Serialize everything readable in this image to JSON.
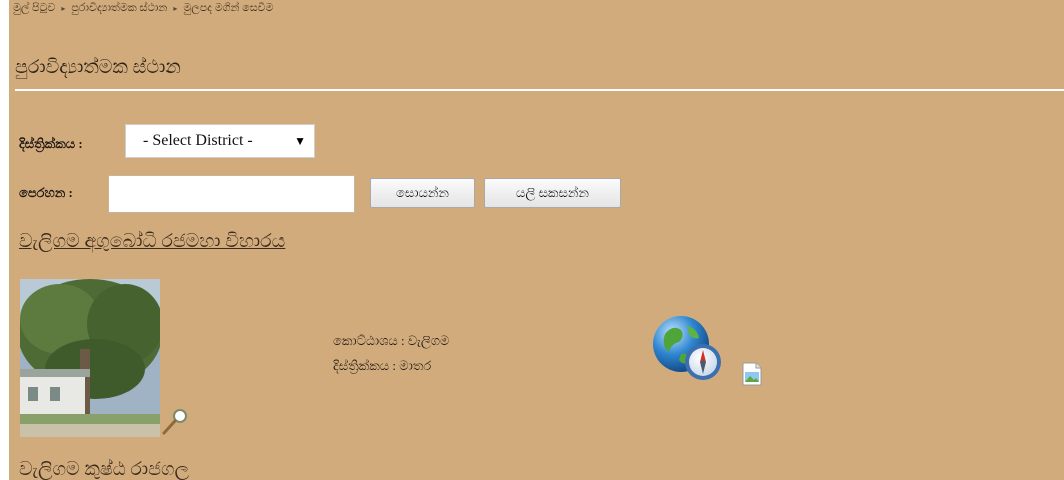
{
  "breadcrumb": {
    "items": [
      "මුල් පිටුව",
      "පුරාවිද්‍යාත්මක ස්ථාන",
      "මුලපද මගින් සෙවීම"
    ],
    "separator": "▸"
  },
  "page": {
    "title": "පුරාවිද්‍යාත්මක ස්ථාන",
    "background": "#d2ab7d"
  },
  "form": {
    "district_label": "දිස්ත්‍රික්කය :",
    "district_selected": "- Select District -",
    "name_label": "පෙරහන :",
    "name_value": "",
    "search_button": "සොයන්න",
    "reset_button": "යලි සකසන්න"
  },
  "results": [
    {
      "title": "වැලිගම අගුබෝධි රජමහා විහාරය",
      "division_line": "කොට්ඨාශය : වැලිගම",
      "district_line": "දිස්ත්‍රික්කය : මාතර",
      "icons": [
        "magnifier-icon",
        "globe-compass-icon",
        "broken-image-icon"
      ]
    },
    {
      "title": "වැලිගම කුෂ්ඨ රාජගල"
    }
  ]
}
